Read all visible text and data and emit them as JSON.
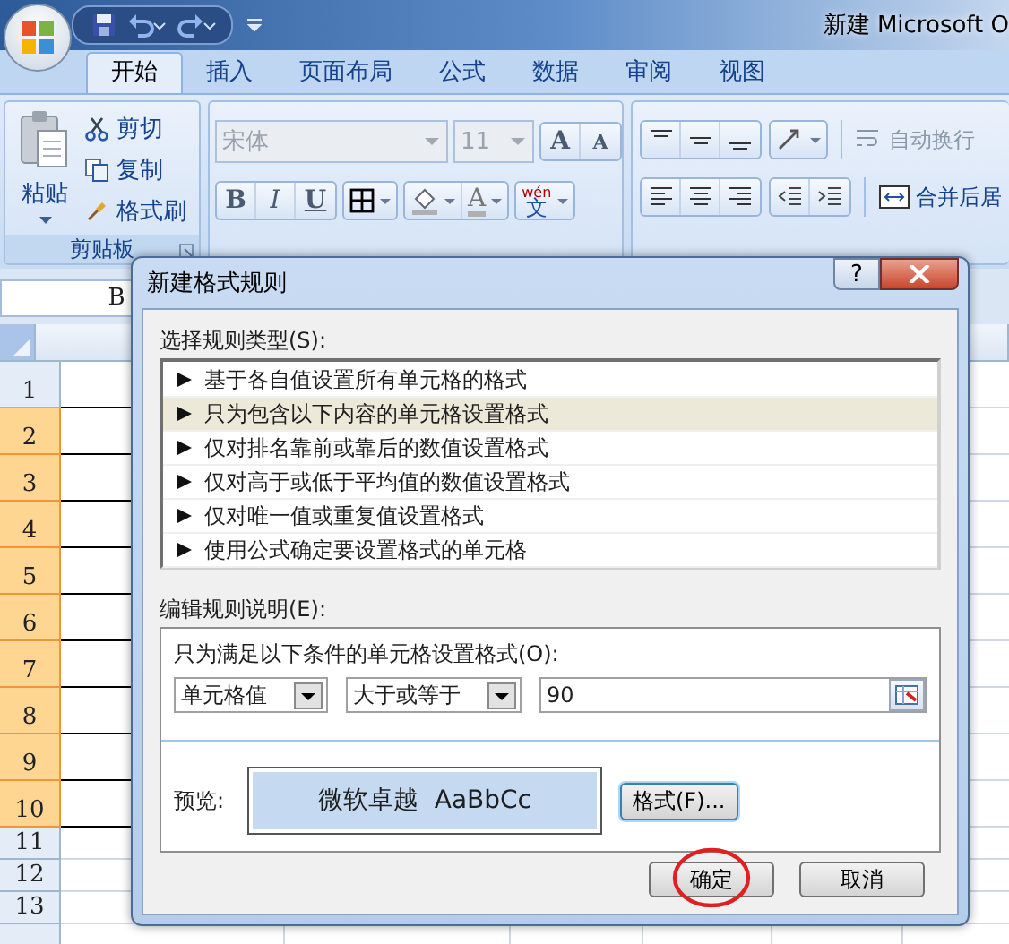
{
  "window": {
    "title": "新建 Microsoft O"
  },
  "tabs": [
    {
      "label": "开始",
      "selected": true
    },
    {
      "label": "插入",
      "selected": false
    },
    {
      "label": "页面布局",
      "selected": false
    },
    {
      "label": "公式",
      "selected": false
    },
    {
      "label": "数据",
      "selected": false
    },
    {
      "label": "审阅",
      "selected": false
    },
    {
      "label": "视图",
      "selected": false
    }
  ],
  "clipboard": {
    "paste": "粘贴",
    "items": [
      {
        "label": "剪切",
        "kind": "cut"
      },
      {
        "label": "复制",
        "kind": "copy"
      },
      {
        "label": "格式刷",
        "kind": "brush"
      }
    ],
    "group_label": "剪贴板"
  },
  "font": {
    "font_name": {
      "value": "宋体",
      "disabled": true
    },
    "font_size": {
      "value": "11",
      "disabled": true
    },
    "grow": "A",
    "shrink": "A",
    "styles": [
      "B",
      "I",
      "U"
    ],
    "font_color": "A",
    "phonetic": {
      "top": "wén",
      "main": "文"
    }
  },
  "alignment": {
    "items": [
      {
        "label": "自动换行",
        "kind": "wrap",
        "disabled": true
      },
      {
        "label": "合并后居",
        "kind": "merge",
        "disabled": false
      }
    ]
  },
  "name_box": "B",
  "rows": [
    {
      "label": "1",
      "selected": false
    },
    {
      "label": "2",
      "selected": true
    },
    {
      "label": "3",
      "selected": true
    },
    {
      "label": "4",
      "selected": true
    },
    {
      "label": "5",
      "selected": true
    },
    {
      "label": "6",
      "selected": true
    },
    {
      "label": "7",
      "selected": true
    },
    {
      "label": "8",
      "selected": true
    },
    {
      "label": "9",
      "selected": true
    },
    {
      "label": "10",
      "selected": true
    },
    {
      "label": "11",
      "selected": false
    },
    {
      "label": "12",
      "selected": false
    },
    {
      "label": "13",
      "selected": false
    }
  ],
  "dialog": {
    "title": "新建格式规则",
    "help": "?",
    "rule_type_label": "选择规则类型(S):",
    "rule_types": [
      {
        "label": "基于各自值设置所有单元格的格式",
        "selected": false
      },
      {
        "label": "只为包含以下内容的单元格设置格式",
        "selected": true
      },
      {
        "label": "仅对排名靠前或靠后的数值设置格式",
        "selected": false
      },
      {
        "label": "仅对高于或低于平均值的数值设置格式",
        "selected": false
      },
      {
        "label": "仅对唯一值或重复值设置格式",
        "selected": false
      },
      {
        "label": "使用公式确定要设置格式的单元格",
        "selected": false
      }
    ],
    "description_label": "编辑规则说明(E):",
    "condition_label": "只为满足以下条件的单元格设置格式(O):",
    "condition": {
      "field": "单元格值",
      "operator": "大于或等于",
      "value": "90"
    },
    "preview_label": "预览:",
    "preview_text": "微软卓越  AaBbCc",
    "format_button": "格式(F)...",
    "buttons": [
      {
        "label": "确定",
        "circled": true
      },
      {
        "label": "取消",
        "circled": false
      }
    ]
  }
}
